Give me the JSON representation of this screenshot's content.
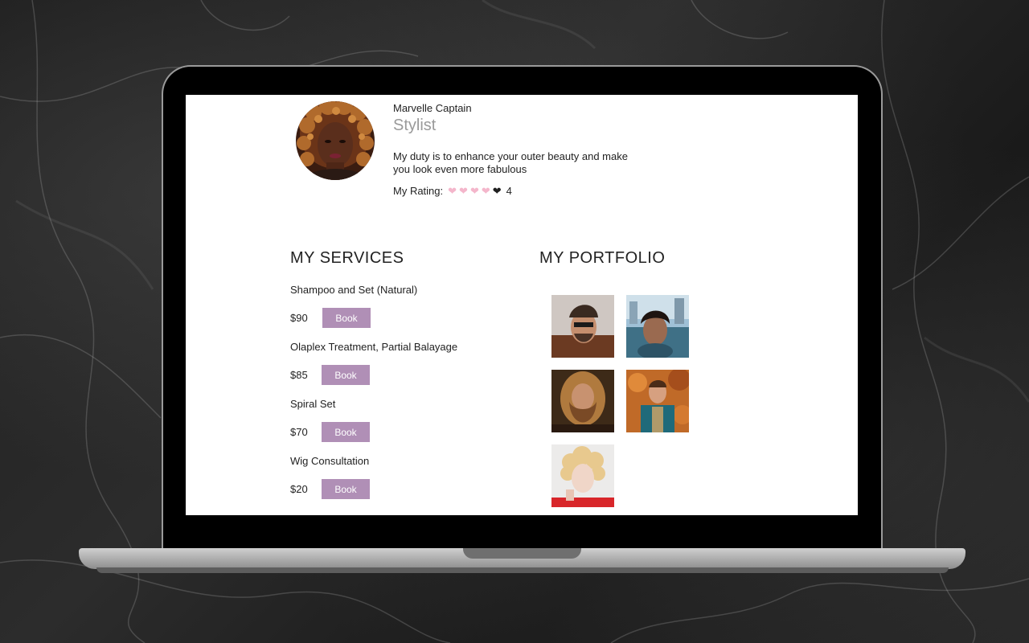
{
  "profile": {
    "name": "Marvelle Captain",
    "role": "Stylist",
    "bio": "My duty is to enhance your outer beauty and make you look even more fabulous",
    "rating_label": "My Rating:",
    "rating_value": "4",
    "rating_hearts_filled": 4,
    "rating_hearts_total": 5
  },
  "services": {
    "title": "MY SERVICES",
    "items": [
      {
        "name": "Shampoo and Set (Natural)",
        "price": "$90",
        "button": "Book"
      },
      {
        "name": "Olaplex Treatment, Partial Balayage",
        "price": "$85",
        "button": "Book"
      },
      {
        "name": "Spiral Set",
        "price": "$70",
        "button": "Book"
      },
      {
        "name": "Wig Consultation",
        "price": "$20",
        "button": "Book"
      }
    ]
  },
  "portfolio": {
    "title": "MY PORTFOLIO",
    "photos": [
      "portfolio-photo-1",
      "portfolio-photo-2",
      "portfolio-photo-3",
      "portfolio-photo-4",
      "portfolio-photo-5"
    ]
  },
  "colors": {
    "accent": "#b08fb6",
    "heart_filled": "#f4b6cb",
    "heart_empty": "#1f1f1f",
    "role_text": "#9a9a9a"
  }
}
